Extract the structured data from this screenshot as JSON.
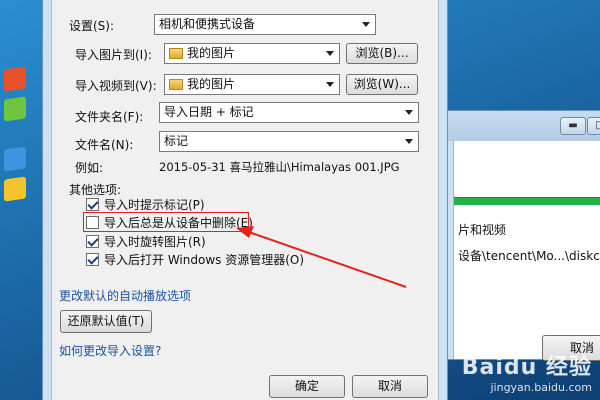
{
  "dialog": {
    "settings_label": "设置(S):",
    "settings_value": "相机和便携式设备",
    "import_pictures_label": "导入图片到(I):",
    "import_pictures_value": "我的图片",
    "browse_pictures_label": "浏览(B)...",
    "import_videos_label": "导入视频到(V):",
    "import_videos_value": "我的图片",
    "browse_videos_label": "浏览(W)...",
    "folder_name_label": "文件夹名(F):",
    "folder_name_value": "导入日期 + 标记",
    "file_name_label": "文件名(N):",
    "file_name_value": "标记",
    "example_label": "例如:",
    "example_value": "2015-05-31 喜马拉雅山\\Himalayas 001.JPG",
    "other_options_label": "其他选项:",
    "options": [
      {
        "label": "导入时提示标记(P)",
        "checked": true
      },
      {
        "label": "导入后总是从设备中删除(E)",
        "checked": false
      },
      {
        "label": "导入时旋转图片(R)",
        "checked": true
      },
      {
        "label": "导入后打开 Windows 资源管理器(O)",
        "checked": true
      }
    ],
    "change_autoplay_link": "更改默认的自动播放选项",
    "restore_defaults_label": "还原默认值(T)",
    "how_to_change_link": "如何更改导入设置?",
    "ok_label": "确定",
    "cancel_label": "取消"
  },
  "background_window": {
    "text1": "片和视频",
    "text2": "设备\\tencent\\Mo...\\diskcach",
    "cancel_label": "取消",
    "minimize_glyph": "▬",
    "maximize_glyph": "□",
    "close_glyph": "×"
  },
  "watermark": {
    "line1": "Baidu 经验",
    "line2": "jingyan.baidu.com"
  },
  "colors": {
    "highlight_red": "#e3241b",
    "link_blue": "#1d52a0",
    "progress_green": "#22b14c"
  }
}
